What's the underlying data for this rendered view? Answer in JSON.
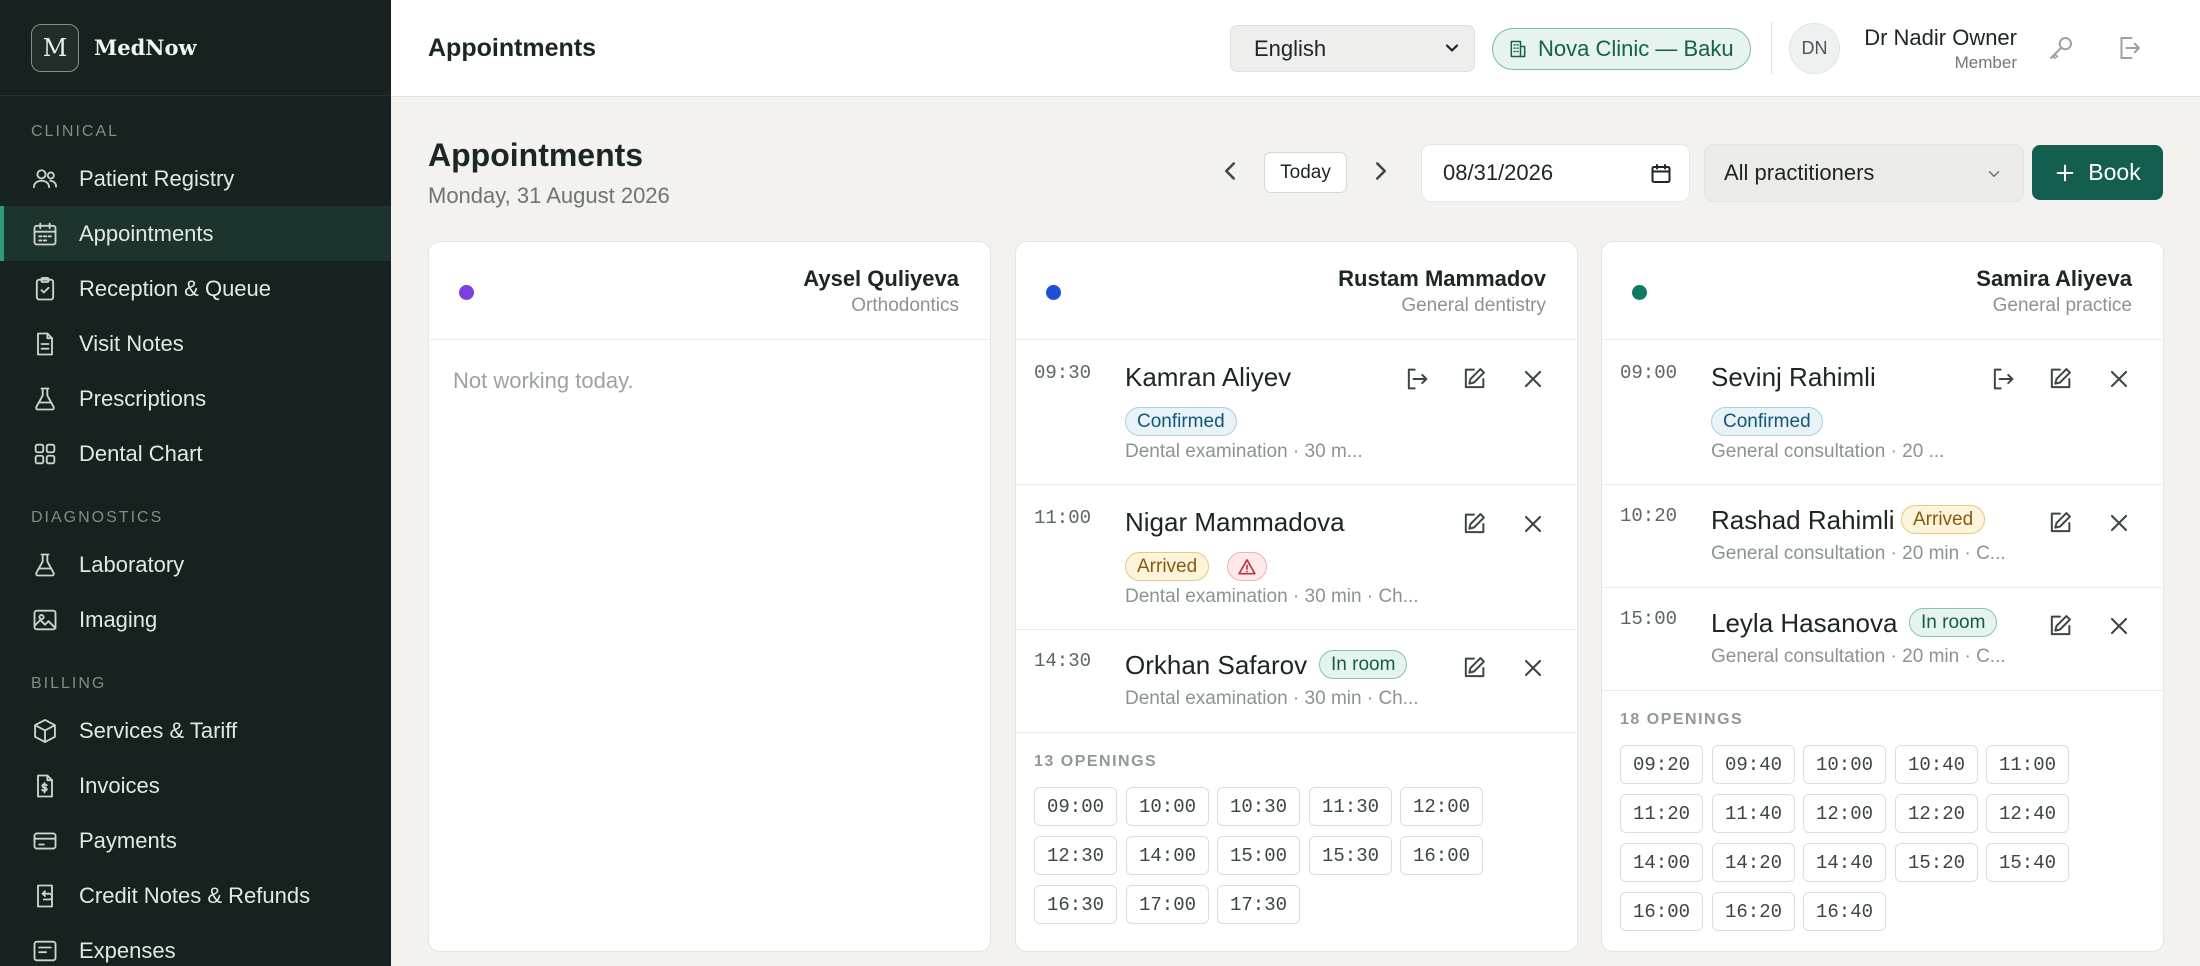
{
  "brand": {
    "logo_letter": "M",
    "name": "MedNow"
  },
  "sidebar": {
    "sections": [
      {
        "label": "CLINICAL",
        "items": [
          {
            "label": "Patient Registry",
            "icon": "users-icon"
          },
          {
            "label": "Appointments",
            "icon": "calendar-icon",
            "active": true
          },
          {
            "label": "Reception & Queue",
            "icon": "clipboard-icon"
          },
          {
            "label": "Visit Notes",
            "icon": "document-icon"
          },
          {
            "label": "Prescriptions",
            "icon": "flask-icon"
          },
          {
            "label": "Dental Chart",
            "icon": "grid-icon"
          }
        ]
      },
      {
        "label": "DIAGNOSTICS",
        "items": [
          {
            "label": "Laboratory",
            "icon": "flask-icon"
          },
          {
            "label": "Imaging",
            "icon": "image-icon"
          }
        ]
      },
      {
        "label": "BILLING",
        "items": [
          {
            "label": "Services & Tariff",
            "icon": "box-icon"
          },
          {
            "label": "Invoices",
            "icon": "invoice-icon"
          },
          {
            "label": "Payments",
            "icon": "card-icon"
          },
          {
            "label": "Credit Notes & Refunds",
            "icon": "refund-icon"
          },
          {
            "label": "Expenses",
            "icon": "receipt-icon"
          }
        ]
      }
    ]
  },
  "topbar": {
    "title": "Appointments",
    "language": "English",
    "clinic": "Nova Clinic — Baku",
    "user_initials": "DN",
    "user_name": "Dr Nadir Owner",
    "user_role": "Member"
  },
  "page": {
    "title": "Appointments",
    "subtitle": "Monday, 31 August 2026",
    "today_label": "Today",
    "date_value": "08/31/2026",
    "practitioner_filter": "All practitioners",
    "book_label": "Book"
  },
  "colors": {
    "accent": "#145e4f",
    "sidebar_bg": "#15221f"
  },
  "columns": [
    {
      "name": "Aysel Quliyeva",
      "specialty": "Orthodontics",
      "dot_color": "#7b3fe0",
      "empty_message": "Not working today."
    },
    {
      "name": "Rustam Mammadov",
      "specialty": "General dentistry",
      "dot_color": "#1e4fd8",
      "appointments": [
        {
          "time": "09:30",
          "patient": "Kamran Aliyev",
          "status": "Confirmed",
          "meta": "Dental examination · 30 m..."
        },
        {
          "time": "11:00",
          "patient": "Nigar Mammadova",
          "status": "Arrived",
          "meta": "Dental examination · 30 min · Ch..."
        },
        {
          "time": "14:30",
          "patient": "Orkhan Safarov",
          "status": "In room",
          "meta": "Dental examination · 30 min · Ch..."
        }
      ],
      "openings_label": "13 OPENINGS",
      "openings": [
        "09:00",
        "10:00",
        "10:30",
        "11:30",
        "12:00",
        "12:30",
        "14:00",
        "15:00",
        "15:30",
        "16:00",
        "16:30",
        "17:00",
        "17:30"
      ]
    },
    {
      "name": "Samira Aliyeva",
      "specialty": "General practice",
      "dot_color": "#0f7a66",
      "appointments": [
        {
          "time": "09:00",
          "patient": "Sevinj Rahimli",
          "status": "Confirmed",
          "meta": "General consultation · 20 ..."
        },
        {
          "time": "10:20",
          "patient": "Rashad Rahimli",
          "status": "Arrived",
          "meta": "General consultation · 20 min · C..."
        },
        {
          "time": "15:00",
          "patient": "Leyla Hasanova",
          "status": "In room",
          "meta": "General consultation · 20 min · C..."
        }
      ],
      "openings_label": "18 OPENINGS",
      "openings": [
        "09:20",
        "09:40",
        "10:00",
        "10:40",
        "11:00",
        "11:20",
        "11:40",
        "12:00",
        "12:20",
        "12:40",
        "14:00",
        "14:20",
        "14:40",
        "15:20",
        "15:40",
        "16:00",
        "16:20",
        "16:40"
      ]
    }
  ]
}
